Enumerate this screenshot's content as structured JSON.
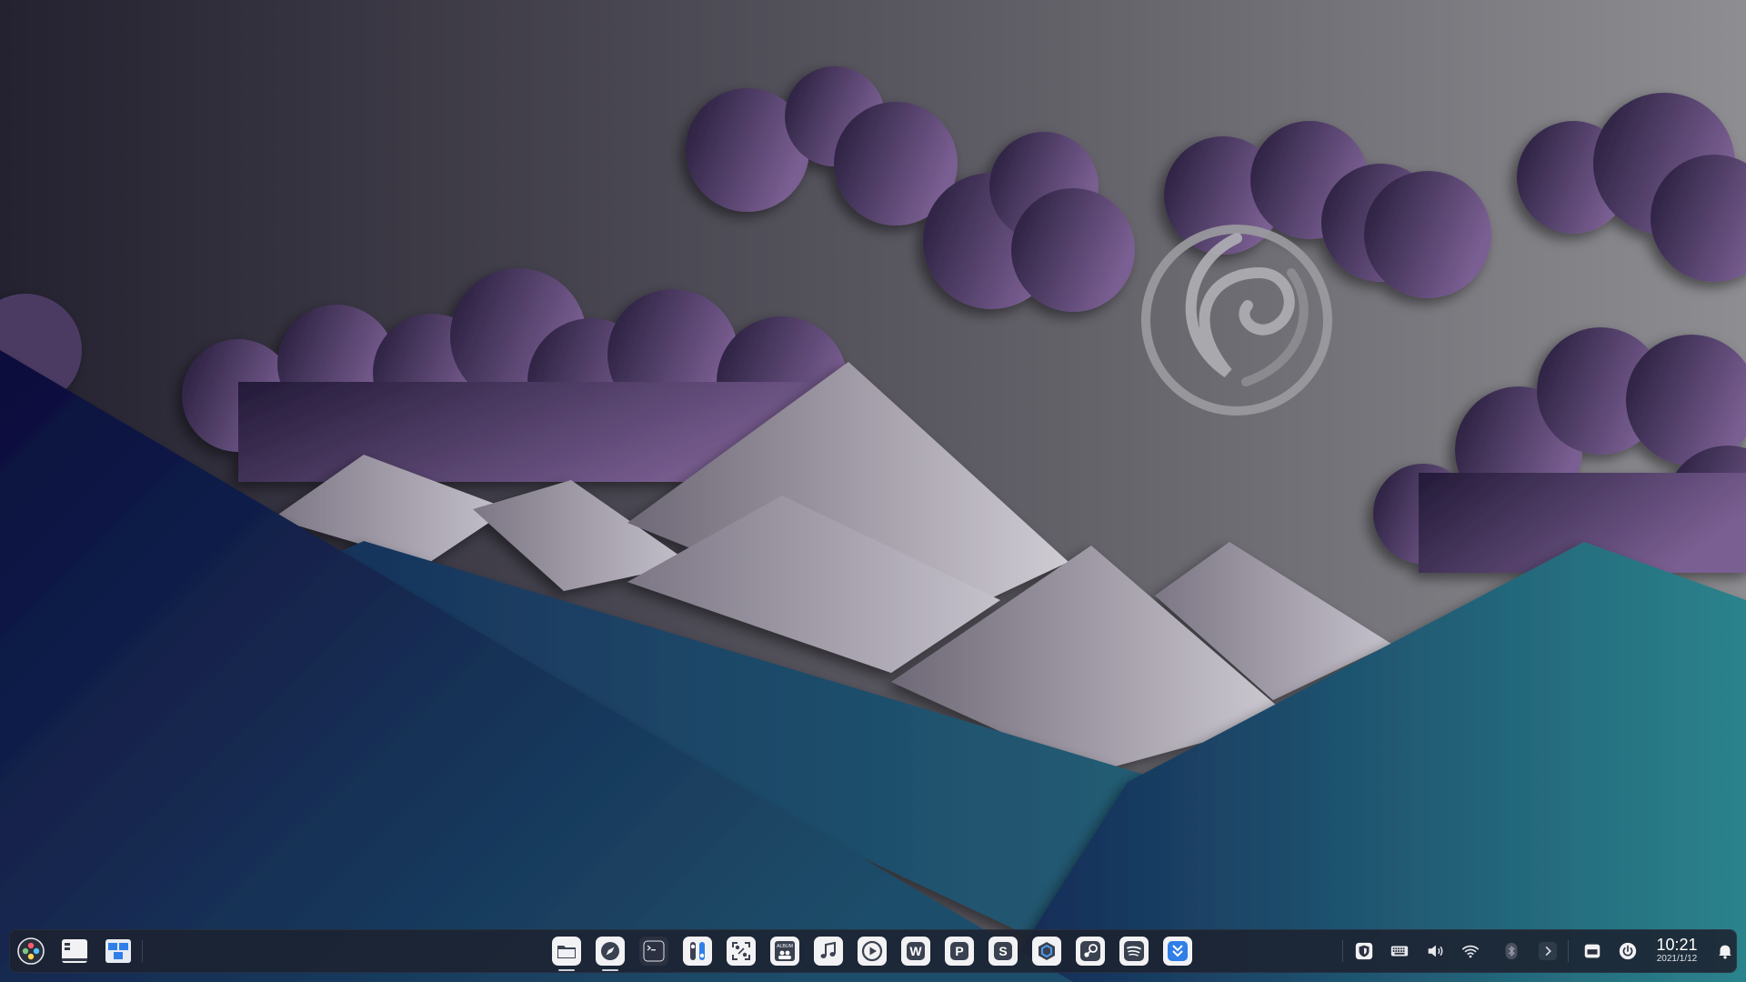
{
  "desktop": {
    "wallpaper": "mountains-clouds-deepin",
    "colors": {
      "sky_dark": "#242130",
      "sky_light": "#8a8a8e",
      "cloud": "#6a5285",
      "mountain_light": "#c4c0ca",
      "hill_navy": "#15204a",
      "hill_teal": "#26727e"
    }
  },
  "taskbar": {
    "left": [
      {
        "id": "launcher",
        "icon": "launcher-icon"
      },
      {
        "id": "show-desktop",
        "icon": "show-desktop-icon"
      },
      {
        "id": "multitasking",
        "icon": "multitask-view-icon"
      }
    ],
    "apps": [
      {
        "id": "file-manager",
        "icon": "folder-icon",
        "running": true
      },
      {
        "id": "browser",
        "icon": "browser-compass-icon",
        "running": true
      },
      {
        "id": "terminal",
        "icon": "terminal-icon",
        "label": ">_",
        "running": false
      },
      {
        "id": "control-center",
        "icon": "settings-toggle-icon",
        "running": false
      },
      {
        "id": "screenshot",
        "icon": "screenshot-icon",
        "running": false
      },
      {
        "id": "album",
        "icon": "album-icon",
        "label": "ALBUM",
        "running": false
      },
      {
        "id": "music",
        "icon": "music-note-icon",
        "running": false
      },
      {
        "id": "movie",
        "icon": "play-icon",
        "running": false
      },
      {
        "id": "writer",
        "icon": "w-letter-icon",
        "label": "W",
        "running": false
      },
      {
        "id": "presentation",
        "icon": "p-letter-icon",
        "label": "P",
        "running": false
      },
      {
        "id": "spreadsheet",
        "icon": "s-letter-icon",
        "label": "S",
        "running": false
      },
      {
        "id": "app-store",
        "icon": "hexagon-icon",
        "running": false
      },
      {
        "id": "steam",
        "icon": "steam-icon",
        "running": false
      },
      {
        "id": "spotify",
        "icon": "spotify-icon",
        "running": false
      },
      {
        "id": "downloader",
        "icon": "download-chevron-icon",
        "running": false
      }
    ],
    "tray": [
      {
        "id": "security",
        "icon": "shield-icon"
      },
      {
        "id": "keyboard",
        "icon": "keyboard-icon"
      },
      {
        "id": "volume",
        "icon": "speaker-icon"
      },
      {
        "id": "wifi",
        "icon": "wifi-icon"
      },
      {
        "id": "bluetooth",
        "icon": "bluetooth-icon"
      },
      {
        "id": "expand",
        "icon": "chevron-right-icon"
      },
      {
        "id": "window-mode",
        "icon": "window-icon"
      },
      {
        "id": "power",
        "icon": "power-icon"
      },
      {
        "id": "notifications",
        "icon": "bell-icon"
      }
    ],
    "clock": {
      "time": "10:21",
      "date": "2021/1/12"
    }
  }
}
